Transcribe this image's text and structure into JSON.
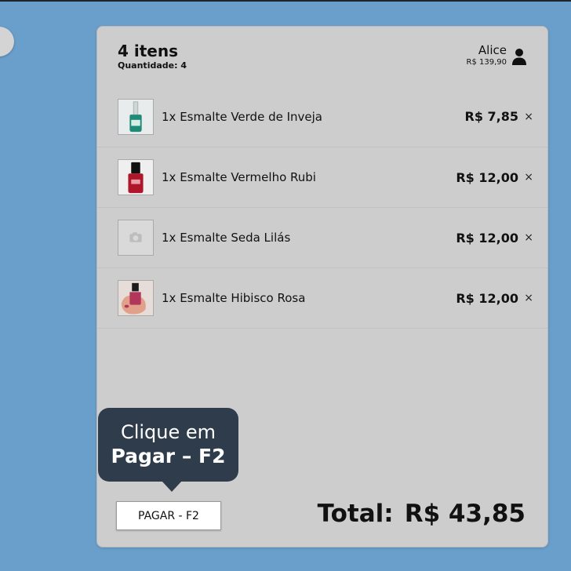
{
  "cart": {
    "title": "4 itens",
    "quantity_label": "Quantidade: 4"
  },
  "user": {
    "name": "Alice",
    "balance": "R$ 139,90",
    "icon": "user-icon"
  },
  "items": [
    {
      "name": "1x Esmalte Verde de Inveja",
      "price": "R$ 7,85",
      "remove": "×",
      "image": "green-polish"
    },
    {
      "name": "1x Esmalte Vermelho Rubi",
      "price": "R$ 12,00",
      "remove": "×",
      "image": "red-polish"
    },
    {
      "name": "1x Esmalte Seda Lilás",
      "price": "R$ 12,00",
      "remove": "×",
      "image": "placeholder-camera"
    },
    {
      "name": "1x Esmalte Hibisco Rosa",
      "price": "R$ 12,00",
      "remove": "×",
      "image": "pink-polish-hand"
    }
  ],
  "tooltip": {
    "line1": "Clique em",
    "line2": "Pagar – F2"
  },
  "pay_button": "PAGAR - F2",
  "total": {
    "label": "Total:",
    "value": "R$ 43,85"
  },
  "colors": {
    "background": "#6a9fcc",
    "panel": "#cdcdcd",
    "tooltip": "#2f3c4b"
  }
}
